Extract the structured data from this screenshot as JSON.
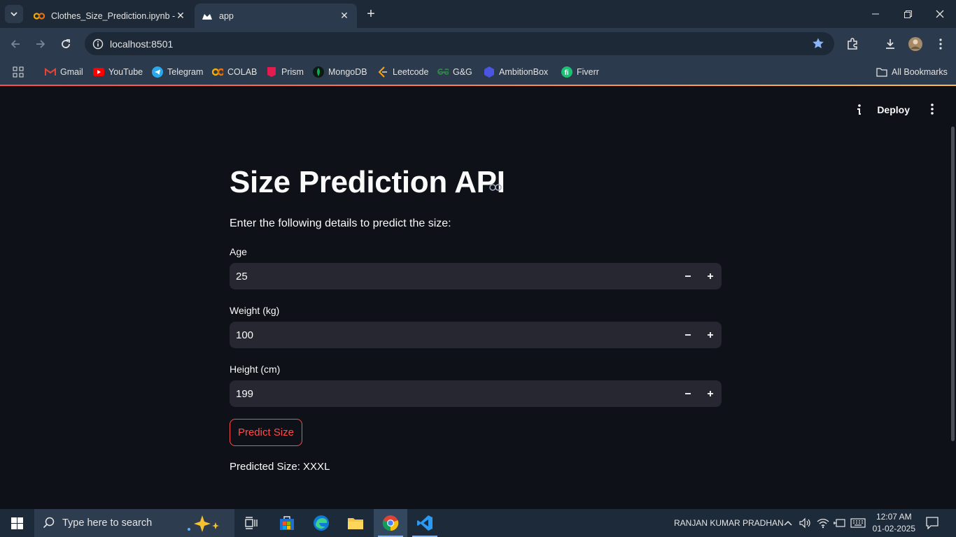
{
  "browser": {
    "tabs": [
      {
        "title": "Clothes_Size_Prediction.ipynb - ",
        "icon": "colab-icon",
        "active": false
      },
      {
        "title": "app",
        "icon": "streamlit-icon",
        "active": true
      }
    ],
    "url": "localhost:8501",
    "bookmarks": [
      {
        "label": "Gmail",
        "icon": "gmail-icon"
      },
      {
        "label": "YouTube",
        "icon": "youtube-icon"
      },
      {
        "label": "Telegram",
        "icon": "telegram-icon"
      },
      {
        "label": "COLAB",
        "icon": "colab-icon"
      },
      {
        "label": "Prism",
        "icon": "prism-icon"
      },
      {
        "label": "MongoDB",
        "icon": "mongodb-icon"
      },
      {
        "label": "Leetcode",
        "icon": "leetcode-icon"
      },
      {
        "label": "G&G",
        "icon": "gfg-icon"
      },
      {
        "label": "AmbitionBox",
        "icon": "ambitionbox-icon"
      },
      {
        "label": "Fiverr",
        "icon": "fiverr-icon"
      }
    ],
    "all_bookmarks": "All Bookmarks"
  },
  "app": {
    "deploy_label": "Deploy",
    "title": "Size Prediction API",
    "subtitle": "Enter the following details to predict the size:",
    "fields": [
      {
        "label": "Age",
        "value": "25"
      },
      {
        "label": "Weight (kg)",
        "value": "100"
      },
      {
        "label": "Height (cm)",
        "value": "199"
      }
    ],
    "predict_button": "Predict Size",
    "result": "Predicted Size: XXXL",
    "colors": {
      "accent": "#ff4b4b",
      "background": "#0e1117",
      "input_bg": "#262730"
    }
  },
  "taskbar": {
    "search_placeholder": "Type here to search",
    "user_name": "RANJAN KUMAR PRADHAN",
    "time": "12:07 AM",
    "date": "01-02-2025"
  }
}
